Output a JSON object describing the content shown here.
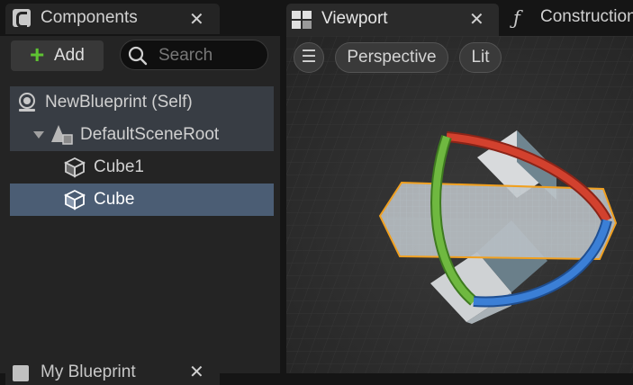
{
  "components_panel": {
    "tab_title": "Components",
    "close_glyph": "✕",
    "add_label": "Add",
    "search_placeholder": "Search",
    "tree": [
      {
        "label": "NewBlueprint (Self)",
        "icon": "blueprint-actor-icon"
      },
      {
        "label": "DefaultSceneRoot",
        "icon": "scene-root-icon",
        "expanded": true
      },
      {
        "label": "Cube1",
        "icon": "static-mesh-icon"
      },
      {
        "label": "Cube",
        "icon": "static-mesh-icon",
        "selected": true
      }
    ]
  },
  "bottom_panel": {
    "tab_title": "My Blueprint",
    "close_glyph": "✕"
  },
  "viewport_tabs": [
    {
      "label": "Viewport",
      "icon": "viewport-icon",
      "active": true,
      "close_glyph": "✕"
    },
    {
      "label": "Construction",
      "icon": "function-icon",
      "glyph": "ƒ"
    }
  ],
  "viewport_toolbar": {
    "menu_glyph": "☰",
    "view_mode": "Perspective",
    "lighting": "Lit"
  },
  "colors": {
    "selection": "#4b5d74",
    "gizmo_x": "#d2412e",
    "gizmo_y": "#6fb840",
    "gizmo_z": "#3b7fd6",
    "selected_outline": "#f0a020"
  }
}
